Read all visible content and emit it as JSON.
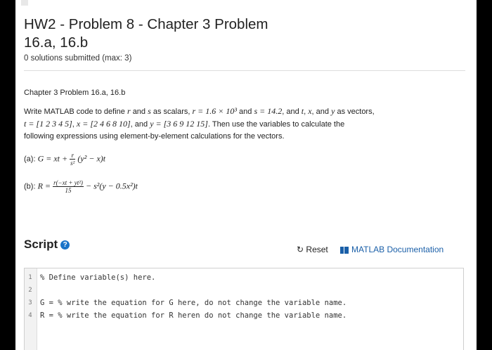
{
  "problem": {
    "title_line1": "HW2 - Problem 8 - Chapter 3 Problem",
    "title_line2": "16.a, 16.b",
    "submissions": "0 solutions submitted (max: 3)"
  },
  "description": {
    "heading": "Chapter 3 Problem 16.a, 16.b",
    "p1": "Write MATLAB code to define",
    "v_r": "r",
    "and": "and",
    "v_s": "s",
    "p2": "as scalars,",
    "r_def": "r = 1.6 × 10³",
    "p3": "and",
    "s_def": "s = 14.2",
    "p4": ", and",
    "v_t": "t",
    "comma": ",",
    "v_x": "x",
    "p5": ", and",
    "v_y": "y",
    "p6": "as vectors,",
    "t_def": "t = [1 2 3 4 5]",
    "x_def": "x = [2 4 6 8 10]",
    "p7": ", and",
    "y_def": "y = [3 6 9 12 15]",
    "p8": ". Then use the variables to calculate the",
    "p9": "following expressions using element-by-element calculations for the vectors."
  },
  "equations": {
    "a_label": "(a):",
    "a_lhs": "G = xt +",
    "a_frac_num": "r",
    "a_frac_den": "s²",
    "a_rhs": "(y² − x)t",
    "b_label": "(b):",
    "b_lhs": "R =",
    "b_frac_num": "r(−xt + yt²)",
    "b_frac_den": "15",
    "b_rhs": "− s²(y − 0.5x²)t"
  },
  "script": {
    "heading": "Script",
    "info_glyph": "?",
    "reset_label": "Reset",
    "reset_glyph": "↻",
    "doc_label": "MATLAB Documentation"
  },
  "editor": {
    "lines": [
      {
        "num": "1",
        "code": "% Define variable(s) here."
      },
      {
        "num": "2",
        "code": ""
      },
      {
        "num": "3",
        "code": "G = % write the equation for G here, do not change the variable name."
      },
      {
        "num": "4",
        "code": "R = % write the equation for R heren do not change the variable name."
      }
    ]
  }
}
